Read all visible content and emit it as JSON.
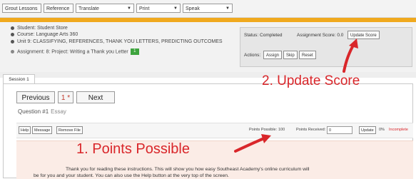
{
  "toolbar": {
    "items": [
      {
        "label": "Grout Lessons",
        "kind": "button"
      },
      {
        "label": "Reference",
        "kind": "button"
      },
      {
        "label": "Translate",
        "kind": "select"
      },
      {
        "label": "Print",
        "kind": "select"
      },
      {
        "label": "Speak",
        "kind": "select"
      }
    ]
  },
  "info": {
    "student": "Student: Student Store",
    "course": "Course: Language Arts 360",
    "unit": "Unit 9: CLASSIFYING, REFERENCES, THANK YOU LETTERS, PREDICTING OUTCOMES",
    "assignment": "Assignment: 8: Project: Writing a Thank you Letter",
    "assignment_badge": "1"
  },
  "score_panel": {
    "status_label": "Status: Completed",
    "assignment_score_label": "Assignment Score: 0.0",
    "update_score_button": "Update Score",
    "actions_label": "Actions:",
    "action_buttons": [
      "Assign",
      "Skip",
      "Reset"
    ]
  },
  "tabs": [
    {
      "label": "Session 1"
    }
  ],
  "pager": {
    "previous_label": "Previous",
    "current_label": "1 *",
    "next_label": "Next"
  },
  "question": {
    "label": "Question #1",
    "type": "Essay"
  },
  "points_row": {
    "buttons": [
      "Help",
      "Message",
      "Remove File"
    ],
    "points_possible_label": "Points Possible:",
    "points_possible_value": "100",
    "points_received_label": "Points Received:",
    "points_received_value": "0",
    "update_button": "Update",
    "percent": "0%",
    "incomplete_label": "Incomplete"
  },
  "instructions": {
    "line1": "Thank you for reading these instructions. This will show you how easy Southeast Academy's online curriculum will",
    "line2": "be for you and your student. You can also use the Help button at the very top of the screen."
  },
  "annotations": {
    "update_score": "2. Update Score",
    "points_possible": "1. Points Possible"
  },
  "colors": {
    "accent_orange": "#f0a91e",
    "annotation_red": "#d9262a",
    "instruction_bg": "#fbece6",
    "badge_green": "#3ea43e"
  }
}
